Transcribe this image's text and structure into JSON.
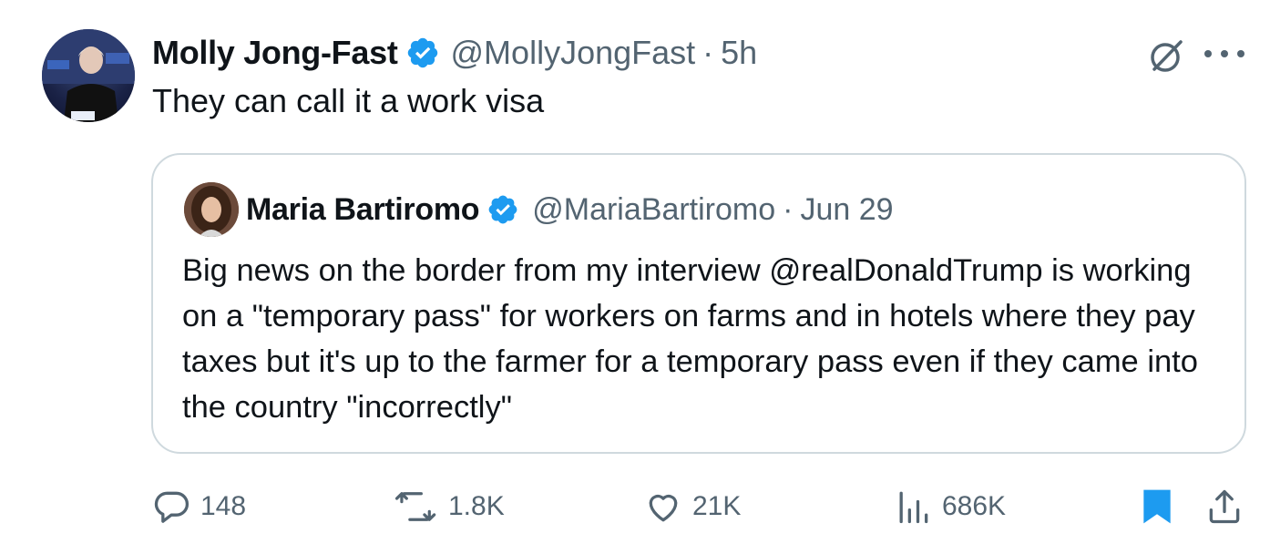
{
  "tweet": {
    "author_name": "Molly Jong-Fast",
    "handle": "@MollyJongFast",
    "separator": "·",
    "time": "5h",
    "text": "They can call it a work visa",
    "avatar_icon": "avatar-photo",
    "verified_icon": "verified-badge-icon",
    "menu_icon": "more-options-icon",
    "grok_icon": "grok-icon"
  },
  "quote": {
    "author_name": "Maria Bartiromo",
    "handle": "@MariaBartiromo",
    "separator": "·",
    "time": "Jun 29",
    "text": "Big news on the border from my interview @realDonaldTrump is working on a \"temporary pass\" for workers on farms and in hotels where they pay taxes but it's up to the farmer for a temporary pass even if they came into the country \"incorrectly\""
  },
  "actions": {
    "replies": "148",
    "reposts": "1.8K",
    "likes": "21K",
    "views": "686K"
  },
  "colors": {
    "verified_blue": "#1d9bf0",
    "text": "#0f1419",
    "secondary_text": "#536471",
    "border": "#cfd9de"
  }
}
